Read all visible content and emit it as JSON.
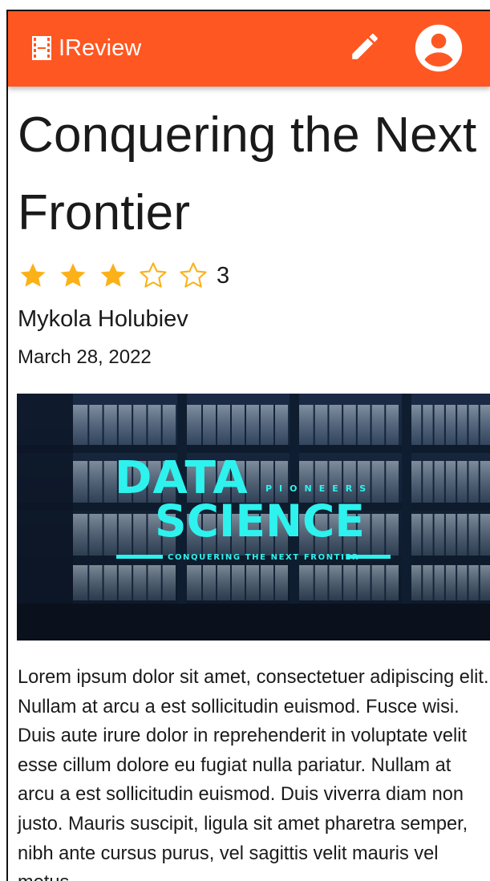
{
  "app": {
    "name": "IReview",
    "brand_color": "#ff5722",
    "logo_icon": "film-icon",
    "actions": [
      {
        "name": "edit",
        "icon": "pencil-icon"
      },
      {
        "name": "account",
        "icon": "account-circle-icon"
      }
    ]
  },
  "article": {
    "title": "Conquering the Next Frontier",
    "rating": {
      "value": "3",
      "stars_filled": 3,
      "stars_total": 5,
      "star_color": "#fbb117"
    },
    "author": "Mykola Holubiev",
    "date": "March 28, 2022",
    "hero": {
      "line1": "DATA",
      "line2": "SCIENCE",
      "tag": "PIONEERS",
      "subtitle": "CONQUERING THE NEXT FRONTIER",
      "text_color": "#2ef2ee"
    },
    "body": "Lorem ipsum dolor sit amet, consectetuer adipiscing elit. Nullam at arcu a est sollicitudin euismod. Fusce wisi. Duis aute irure dolor in reprehenderit in voluptate velit esse cillum dolore eu fugiat nulla pariatur. Nullam at arcu a est sollicitudin euismod. Duis viverra diam non justo. Mauris suscipit, ligula sit amet pharetra semper, nibh ante cursus purus, vel sagittis velit mauris vel metus."
  }
}
